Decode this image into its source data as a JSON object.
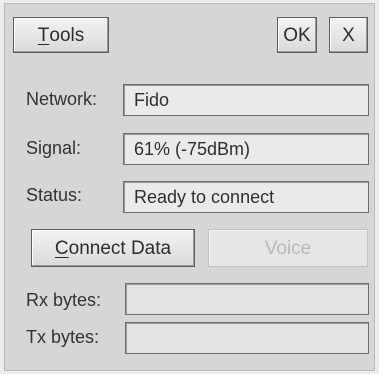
{
  "toolbar": {
    "tools_prefix": "T",
    "tools_rest": "ools",
    "ok_label": "OK",
    "close_label": "X"
  },
  "form": {
    "network_label": "Network:",
    "network_value": "Fido",
    "signal_label": "Signal:",
    "signal_value": "61% (-75dBm)",
    "status_label": "Status:",
    "status_value": "Ready to connect",
    "rx_label": "Rx bytes:",
    "rx_value": "",
    "tx_label": "Tx bytes:",
    "tx_value": ""
  },
  "actions": {
    "connect_prefix": "C",
    "connect_rest": "onnect Data",
    "voice_label": "Voice"
  }
}
